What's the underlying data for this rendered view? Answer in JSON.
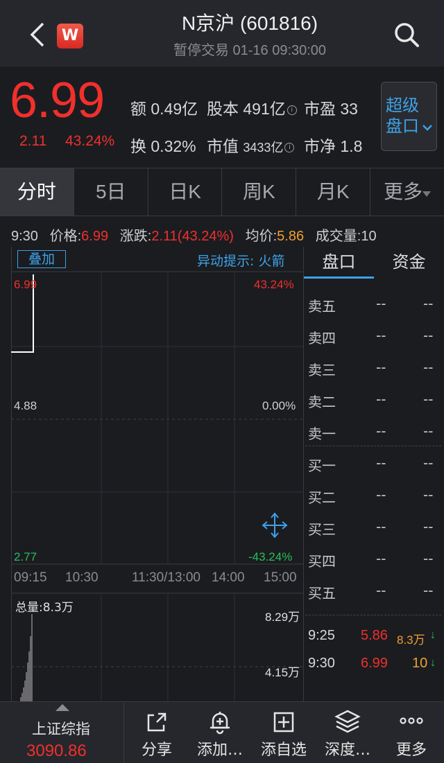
{
  "header": {
    "title": "N京沪 (601816)",
    "subtitle": "暂停交易 01-16 09:30:00",
    "logo_letter": "W"
  },
  "quote": {
    "price": "6.99",
    "change": "2.11",
    "change_pct": "43.24%",
    "stats": {
      "amount_label": "额",
      "amount": "0.49亿",
      "shares_label": "股本",
      "shares": "491亿",
      "pe_label": "市盈",
      "pe": "33",
      "turnover_label": "换",
      "turnover": "0.32%",
      "mcap_label": "市值",
      "mcap": "3433亿",
      "pb_label": "市净",
      "pb": "1.8"
    },
    "super_button": [
      "超级",
      "盘口"
    ]
  },
  "tabs": [
    "分时",
    "5日",
    "日K",
    "周K",
    "月K",
    "更多"
  ],
  "quote_line": {
    "time": "9:30",
    "price_label": "价格:",
    "price": "6.99",
    "chg_label": "涨跌:",
    "chg": "2.11(43.24%)",
    "avg_label": "均价:",
    "avg": "5.86",
    "vol_label": "成交量:",
    "vol": "10"
  },
  "chart": {
    "overlay_button": "叠加",
    "alert_text": "异动提示: 火箭",
    "y_left": [
      "6.99",
      "4.88",
      "2.77"
    ],
    "y_right": [
      "43.24%",
      "0.00%",
      "-43.24%"
    ],
    "x_labels": [
      "09:15",
      "10:30",
      "11:30/13:00",
      "14:00",
      "15:00"
    ],
    "volume_total": "总量:8.3万",
    "volume_ticks": [
      "8.29万",
      "4.15万"
    ],
    "colors": {
      "up": "#f0302c",
      "down": "#26c05a",
      "accent": "#3ca3e8"
    }
  },
  "panel": {
    "tabs": [
      "盘口",
      "资金"
    ],
    "sells": [
      {
        "label": "卖五",
        "price": "--",
        "vol": "--"
      },
      {
        "label": "卖四",
        "price": "--",
        "vol": "--"
      },
      {
        "label": "卖三",
        "price": "--",
        "vol": "--"
      },
      {
        "label": "卖二",
        "price": "--",
        "vol": "--"
      },
      {
        "label": "卖一",
        "price": "--",
        "vol": "--"
      }
    ],
    "buys": [
      {
        "label": "买一",
        "price": "--",
        "vol": "--"
      },
      {
        "label": "买二",
        "price": "--",
        "vol": "--"
      },
      {
        "label": "买三",
        "price": "--",
        "vol": "--"
      },
      {
        "label": "买四",
        "price": "--",
        "vol": "--"
      },
      {
        "label": "买五",
        "price": "--",
        "vol": "--"
      }
    ],
    "trades": [
      {
        "time": "9:25",
        "price": "5.86",
        "vol": "8.3万",
        "dir": "↓"
      },
      {
        "time": "9:30",
        "price": "6.99",
        "vol": "10",
        "dir": "↓"
      }
    ]
  },
  "bottom": {
    "index_name": "上证综指",
    "index_value": "3090.86",
    "items": [
      {
        "label": "分享",
        "icon": "share-icon"
      },
      {
        "label": "添加…",
        "icon": "alarm-bell-icon"
      },
      {
        "label": "添自选",
        "icon": "add-watchlist-icon"
      },
      {
        "label": "深度…",
        "icon": "layers-icon"
      },
      {
        "label": "更多",
        "icon": "more-dots-icon"
      }
    ]
  }
}
